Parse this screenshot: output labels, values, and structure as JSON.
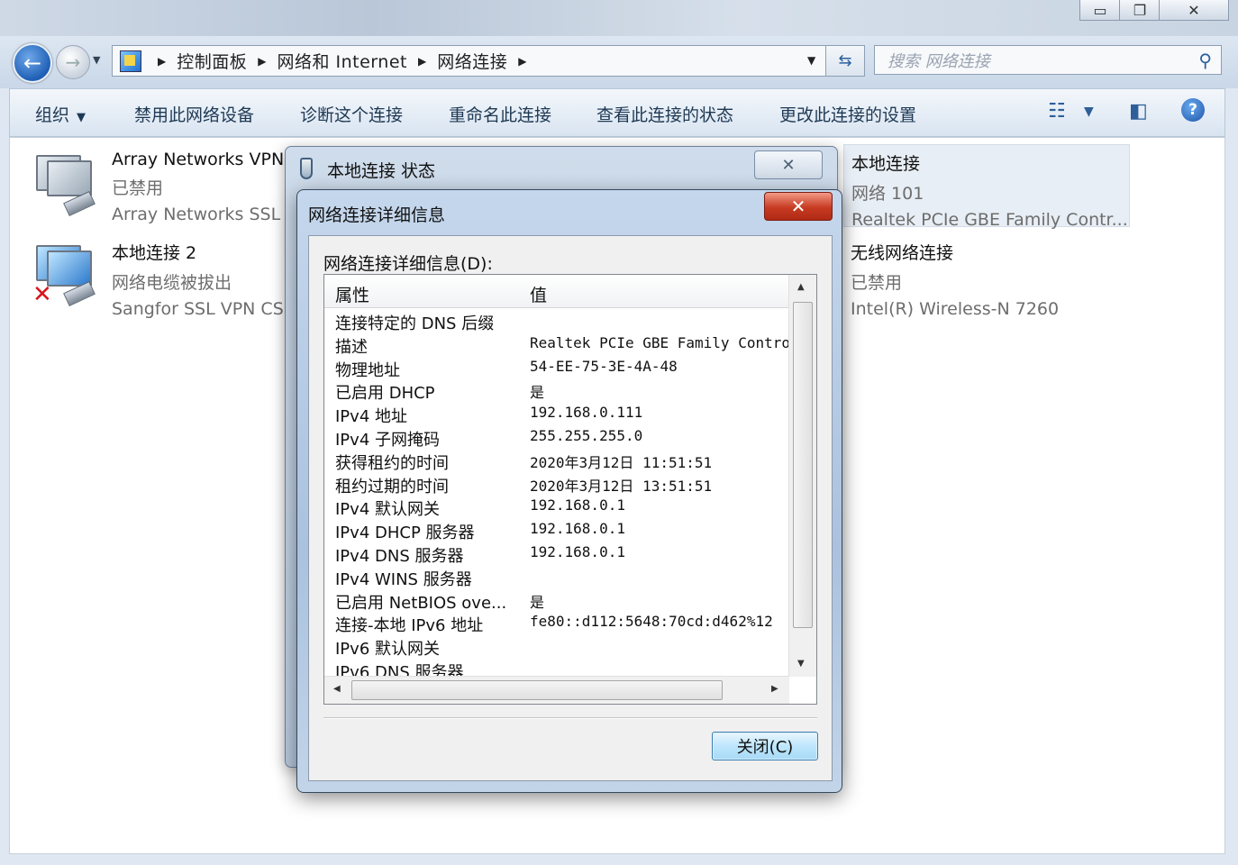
{
  "window": {
    "minimize_glyph": "▭",
    "maximize_glyph": "❐",
    "close_glyph": "✕"
  },
  "breadcrumb": [
    "控制面板",
    "网络和 Internet",
    "网络连接"
  ],
  "search": {
    "placeholder": "搜索 网络连接"
  },
  "toolbar": {
    "organize": "组织",
    "items": [
      "禁用此网络设备",
      "诊断这个连接",
      "重命名此连接",
      "查看此连接的状态",
      "更改此连接的设置"
    ]
  },
  "connections": {
    "array": {
      "name": "Array Networks VPN",
      "status": "已禁用",
      "device": "Array Networks SSL"
    },
    "local2": {
      "name": "本地连接 2",
      "status": "网络电缆被拔出",
      "device": "Sangfor SSL VPN CS"
    },
    "local": {
      "name": "本地连接",
      "status": "网络 101",
      "device": "Realtek PCIe GBE Family Contr..."
    },
    "wireless": {
      "name": "无线网络连接",
      "status": "已禁用",
      "device": "Intel(R) Wireless-N 7260"
    }
  },
  "status_dialog": {
    "title": "本地连接 状态"
  },
  "details_dialog": {
    "title": "网络连接详细信息",
    "label": "网络连接详细信息(D):",
    "headers": {
      "property": "属性",
      "value": "值"
    },
    "rows": [
      {
        "property": "连接特定的 DNS 后缀",
        "value": ""
      },
      {
        "property": "描述",
        "value": "Realtek PCIe GBE Family Contro"
      },
      {
        "property": "物理地址",
        "value": "54-EE-75-3E-4A-48"
      },
      {
        "property": "已启用 DHCP",
        "value": "是"
      },
      {
        "property": "IPv4 地址",
        "value": "192.168.0.111"
      },
      {
        "property": "IPv4 子网掩码",
        "value": "255.255.255.0"
      },
      {
        "property": "获得租约的时间",
        "value": "2020年3月12日 11:51:51"
      },
      {
        "property": "租约过期的时间",
        "value": "2020年3月12日 13:51:51"
      },
      {
        "property": "IPv4 默认网关",
        "value": "192.168.0.1"
      },
      {
        "property": "IPv4 DHCP 服务器",
        "value": "192.168.0.1"
      },
      {
        "property": "IPv4 DNS 服务器",
        "value": "192.168.0.1"
      },
      {
        "property": "IPv4 WINS 服务器",
        "value": ""
      },
      {
        "property": "已启用 NetBIOS ove...",
        "value": "是"
      },
      {
        "property": "连接-本地 IPv6 地址",
        "value": "fe80::d112:5648:70cd:d462%12"
      },
      {
        "property": "IPv6 默认网关",
        "value": ""
      },
      {
        "property": "IPv6 DNS 服务器",
        "value": ""
      }
    ],
    "close_button": "关闭(C)"
  },
  "colors": {
    "accent": "#1f5fb5",
    "close_red": "#c73a22"
  }
}
